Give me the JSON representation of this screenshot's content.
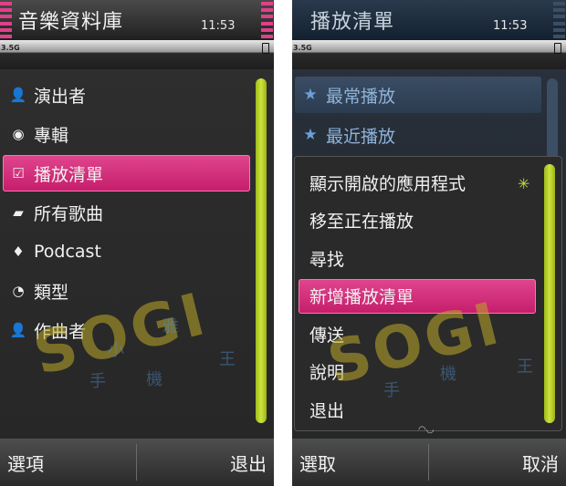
{
  "left": {
    "title": "音樂資料庫",
    "clock": "11:53",
    "network": "3.5G",
    "items": [
      {
        "icon": "person-icon",
        "glyph": "👤",
        "label": "演出者",
        "selected": false
      },
      {
        "icon": "disc-icon",
        "glyph": "◉",
        "label": "專輯",
        "selected": false
      },
      {
        "icon": "checkbox-icon",
        "glyph": "☑",
        "label": "播放清單",
        "selected": true
      },
      {
        "icon": "folder-icon",
        "glyph": "▰",
        "label": "所有歌曲",
        "selected": false
      },
      {
        "icon": "podcast-icon",
        "glyph": "♦",
        "label": "Podcast",
        "selected": false
      },
      {
        "icon": "genre-icon",
        "glyph": "◔",
        "label": "類型",
        "selected": false
      },
      {
        "icon": "composer-icon",
        "glyph": "👤",
        "label": "作曲者",
        "selected": false
      }
    ],
    "softkey_left": "選項",
    "softkey_right": "退出"
  },
  "right": {
    "title": "播放清單",
    "clock": "11:53",
    "network": "3.5G",
    "favorites": [
      {
        "icon": "star-icon",
        "glyph": "★",
        "label": "最常播放"
      },
      {
        "icon": "star-icon",
        "glyph": "★",
        "label": "最近播放"
      }
    ],
    "menu": [
      {
        "label": "顯示開啟的應用程式",
        "selected": false
      },
      {
        "label": "移至正在播放",
        "selected": false
      },
      {
        "label": "尋找",
        "selected": false
      },
      {
        "label": "新增播放清單",
        "selected": true
      },
      {
        "label": "傳送",
        "selected": false
      },
      {
        "label": "說明",
        "selected": false
      },
      {
        "label": "退出",
        "selected": false
      }
    ],
    "softkey_left": "選取",
    "softkey_right": "取消"
  },
  "watermark": {
    "brand": "SOGI",
    "chars": [
      "手",
      "小",
      "機",
      "雅",
      "王"
    ]
  },
  "colors": {
    "highlight": "#d02a78",
    "scroll": "#b8d02a",
    "star": "#6da0d8"
  }
}
